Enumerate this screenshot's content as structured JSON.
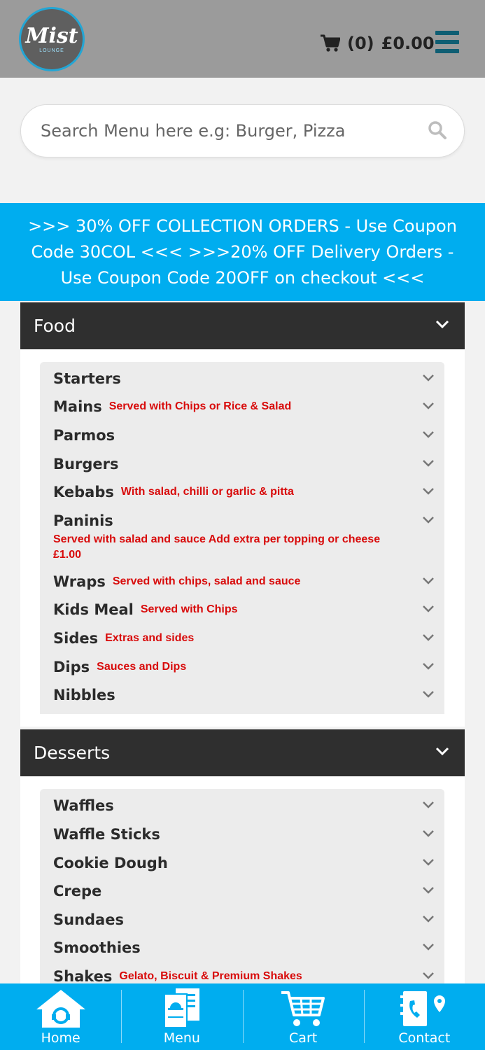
{
  "header": {
    "logo_text": "Mist",
    "logo_sub": "LOUNGE",
    "cart_count": "(0)",
    "cart_total": "£0.00"
  },
  "search": {
    "placeholder": "Search Menu here e.g: Burger, Pizza"
  },
  "promo": {
    "text": ">>> 30% OFF COLLECTION ORDERS - Use Coupon Code 30COL <<< >>>20% OFF Delivery Orders - Use Coupon Code 20OFF on checkout <<<"
  },
  "sections": [
    {
      "title": "Food",
      "items": [
        {
          "name": "Starters",
          "desc": ""
        },
        {
          "name": "Mains",
          "desc": "Served with Chips or Rice & Salad"
        },
        {
          "name": "Parmos",
          "desc": ""
        },
        {
          "name": "Burgers",
          "desc": ""
        },
        {
          "name": "Kebabs",
          "desc": "With salad, chilli or garlic & pitta"
        },
        {
          "name": "Paninis",
          "desc": "Served with salad and sauce Add extra per topping or cheese £1.00"
        },
        {
          "name": "Wraps",
          "desc": "Served with chips, salad and sauce"
        },
        {
          "name": "Kids Meal",
          "desc": "Served with Chips"
        },
        {
          "name": "Sides",
          "desc": "Extras and sides"
        },
        {
          "name": "Dips",
          "desc": "Sauces and Dips"
        },
        {
          "name": "Nibbles",
          "desc": ""
        }
      ]
    },
    {
      "title": "Desserts",
      "items": [
        {
          "name": "Waffles",
          "desc": ""
        },
        {
          "name": "Waffle Sticks",
          "desc": ""
        },
        {
          "name": "Cookie Dough",
          "desc": ""
        },
        {
          "name": "Crepe",
          "desc": ""
        },
        {
          "name": "Sundaes",
          "desc": ""
        },
        {
          "name": "Smoothies",
          "desc": ""
        },
        {
          "name": "Shakes",
          "desc": "Gelato, Biscuit & Premium Shakes"
        }
      ]
    }
  ],
  "bottom_nav": [
    {
      "label": "Home",
      "icon": "home-icon"
    },
    {
      "label": "Menu",
      "icon": "menu-book-icon"
    },
    {
      "label": "Cart",
      "icon": "cart-icon"
    },
    {
      "label": "Contact",
      "icon": "contact-icon"
    }
  ],
  "colors": {
    "header_bg": "#9b9b9b",
    "accent": "#00adef",
    "section_head_bg": "#2f2f2f",
    "desc_red": "#d80b0b",
    "hamburger": "#0f5e73"
  }
}
